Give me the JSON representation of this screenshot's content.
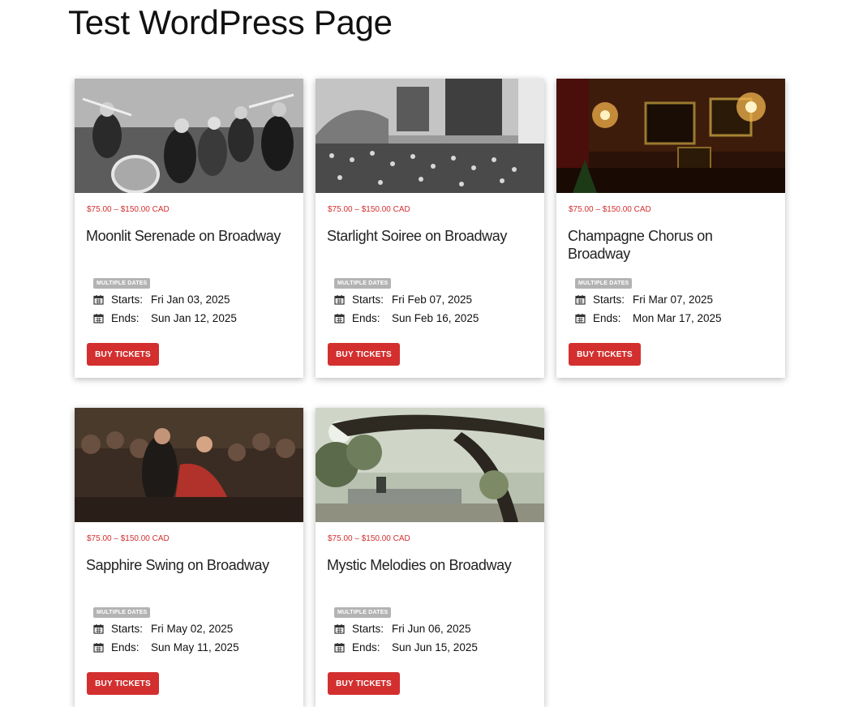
{
  "page": {
    "title": "Test WordPress Page"
  },
  "events": [
    {
      "price": "$75.00 – $150.00 CAD",
      "title": "Moonlit Serenade on Broadway",
      "badge": "MULTIPLE DATES",
      "starts_label": "Starts:",
      "starts": "Fri Jan 03, 2025",
      "ends_label": "Ends:",
      "ends": "Sun Jan 12, 2025",
      "button": "BUY TICKETS",
      "image_alt": "jazz band black and white photo"
    },
    {
      "price": "$75.00 – $150.00 CAD",
      "title": "Starlight Soiree on Broadway",
      "badge": "MULTIPLE DATES",
      "starts_label": "Starts:",
      "starts": "Fri Feb 07, 2025",
      "ends_label": "Ends:",
      "ends": "Sun Feb 16, 2025",
      "button": "BUY TICKETS",
      "image_alt": "vintage theater crowd photo"
    },
    {
      "price": "$75.00 – $150.00 CAD",
      "title": "Champagne Chorus on Broadway",
      "badge": "MULTIPLE DATES",
      "starts_label": "Starts:",
      "starts": "Fri Mar 07, 2025",
      "ends_label": "Ends:",
      "ends": "Mon Mar 17, 2025",
      "button": "BUY TICKETS",
      "image_alt": "ornate room with chandeliers"
    },
    {
      "price": "$75.00 – $150.00 CAD",
      "title": "Sapphire Swing on Broadway",
      "badge": "MULTIPLE DATES",
      "starts_label": "Starts:",
      "starts": "Fri May 02, 2025",
      "ends_label": "Ends:",
      "ends": "Sun May 11, 2025",
      "button": "BUY TICKETS",
      "image_alt": "couple dancing swing in crowd"
    },
    {
      "price": "$75.00 – $150.00 CAD",
      "title": "Mystic Melodies on Broadway",
      "badge": "MULTIPLE DATES",
      "starts_label": "Starts:",
      "starts": "Fri Jun 06, 2025",
      "ends_label": "Ends:",
      "ends": "Sun Jun 15, 2025",
      "button": "BUY TICKETS",
      "image_alt": "misty park with oak tree"
    }
  ],
  "colors": {
    "accent": "#d32f2f",
    "badge": "#b3b3b3"
  }
}
